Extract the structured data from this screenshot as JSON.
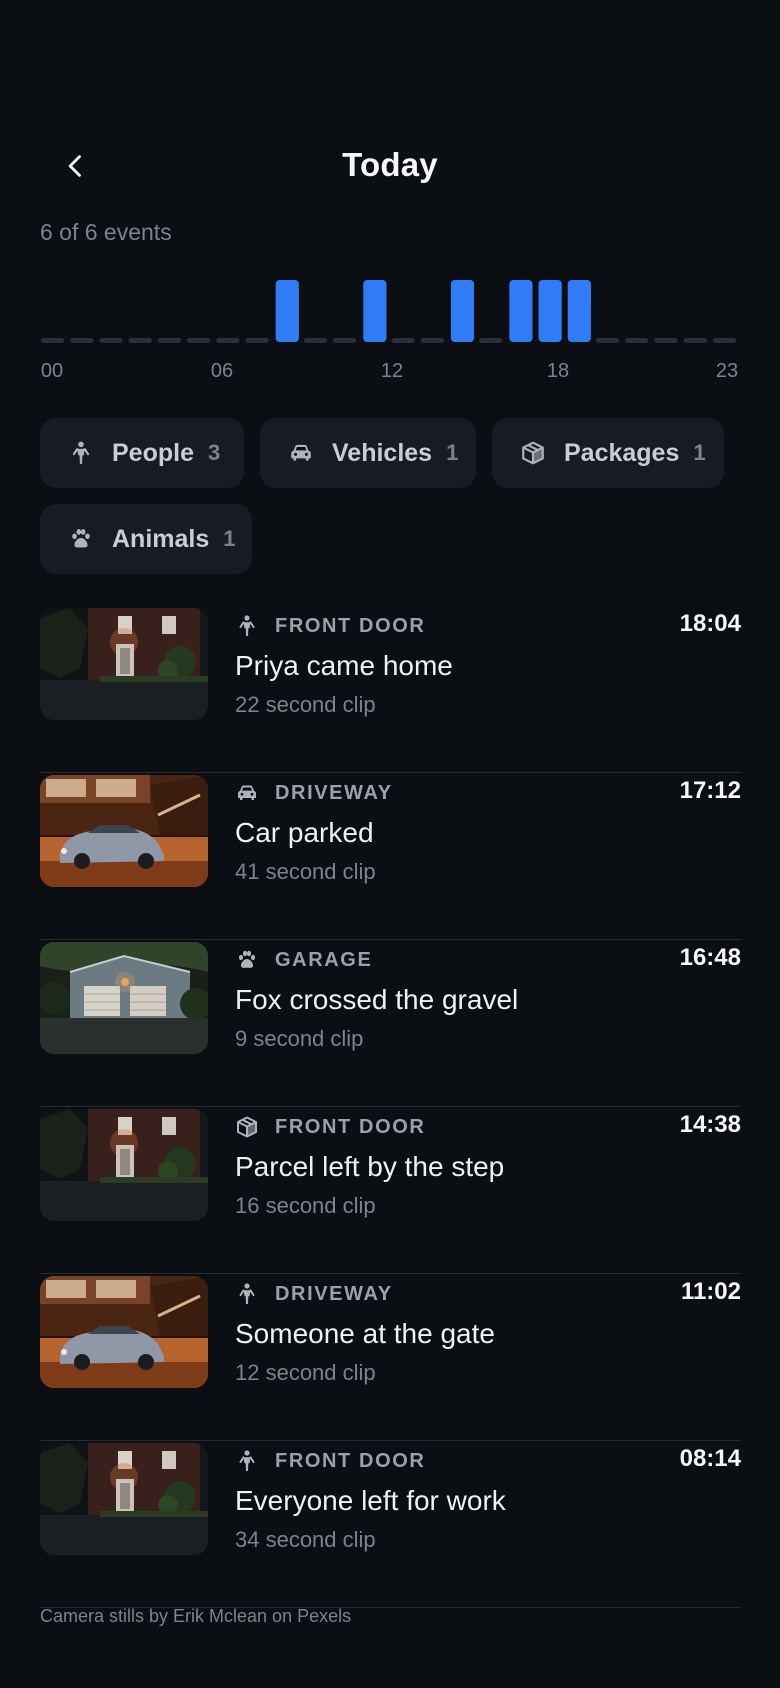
{
  "header": {
    "title": "Today",
    "event_count": "6 of 6 events"
  },
  "timeline": {
    "hours": 24,
    "event_hours": [
      8,
      11,
      14,
      16,
      17,
      18
    ],
    "tick_labels": [
      "00",
      "06",
      "12",
      "18",
      "23"
    ],
    "colors": {
      "event": "#2f7cf6",
      "track": "#2b3038"
    }
  },
  "filters": [
    {
      "label": "People",
      "count": "3",
      "icon": "person-icon"
    },
    {
      "label": "Vehicles",
      "count": "1",
      "icon": "car-icon"
    },
    {
      "label": "Packages",
      "count": "1",
      "icon": "package-icon"
    },
    {
      "label": "Animals",
      "count": "1",
      "icon": "paw-icon"
    }
  ],
  "events": [
    {
      "camera": "FRONT DOOR",
      "time": "18:04",
      "title": "Priya came home",
      "clip": "22 second clip",
      "icon": "person-icon",
      "thumb": "front-door"
    },
    {
      "camera": "DRIVEWAY",
      "time": "17:12",
      "title": "Car parked",
      "clip": "41 second clip",
      "icon": "car-icon",
      "thumb": "driveway"
    },
    {
      "camera": "GARAGE",
      "time": "16:48",
      "title": "Fox crossed the gravel",
      "clip": "9 second clip",
      "icon": "paw-icon",
      "thumb": "garage"
    },
    {
      "camera": "FRONT DOOR",
      "time": "14:38",
      "title": "Parcel left by the step",
      "clip": "16 second clip",
      "icon": "package-icon",
      "thumb": "front-door"
    },
    {
      "camera": "DRIVEWAY",
      "time": "11:02",
      "title": "Someone at the gate",
      "clip": "12 second clip",
      "icon": "person-icon",
      "thumb": "driveway"
    },
    {
      "camera": "FRONT DOOR",
      "time": "08:14",
      "title": "Everyone left for work",
      "clip": "34 second clip",
      "icon": "person-icon",
      "thumb": "front-door"
    }
  ],
  "footer": {
    "credit": "Camera stills by Erik Mclean on Pexels"
  }
}
